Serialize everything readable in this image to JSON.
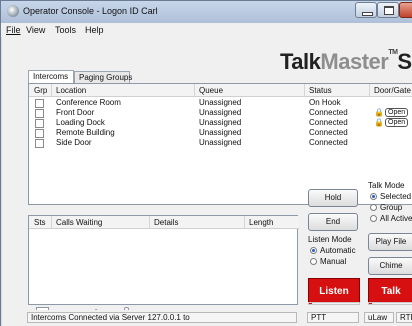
{
  "window": {
    "title": "Operator Console - Logon ID Carl"
  },
  "menu": [
    "File",
    "View",
    "Tools",
    "Help"
  ],
  "brand": {
    "part1": "Talk",
    "part2": "Master",
    "tm": "TM",
    "part3": "Solo"
  },
  "tabs": [
    "Intercoms",
    "Paging Groups"
  ],
  "intercom_table": {
    "headers": [
      "Grp",
      "Location",
      "Queue",
      "Status",
      "Door/Gate"
    ],
    "rows": [
      {
        "location": "Conference Room",
        "queue": "Unassigned",
        "status": "On Hook",
        "door": ""
      },
      {
        "location": "Front Door",
        "queue": "Unassigned",
        "status": "Connected",
        "door": "Open"
      },
      {
        "location": "Loading Dock",
        "queue": "Unassigned",
        "status": "Connected",
        "door": "Open"
      },
      {
        "location": "Remote Building",
        "queue": "Unassigned",
        "status": "Connected",
        "door": ""
      },
      {
        "location": "Side Door",
        "queue": "Unassigned",
        "status": "Connected",
        "door": ""
      }
    ]
  },
  "calls_table": {
    "headers": [
      "Sts",
      "Calls Waiting",
      "Details",
      "Length"
    ]
  },
  "buttons": {
    "hold": "Hold",
    "end": "End",
    "play_file": "Play File",
    "chime": "Chime",
    "listen": "Listen",
    "talk": "Talk"
  },
  "talk_mode": {
    "label": "Talk Mode",
    "options": [
      "Selected",
      "Group",
      "All Active"
    ],
    "selected": "Selected"
  },
  "listen_mode": {
    "label": "Listen Mode",
    "options": [
      "Automatic",
      "Manual"
    ],
    "selected": "Automatic"
  },
  "playback": {
    "play_icon": "play-icon",
    "stop_icon": "stop-icon",
    "speaker_icon": "speaker-icon"
  },
  "status_bar": {
    "message": "Intercoms Connected via Server 127.0.0.1 to",
    "ptt": "PTT",
    "codec": "uLaw",
    "rtp": "RTP"
  }
}
